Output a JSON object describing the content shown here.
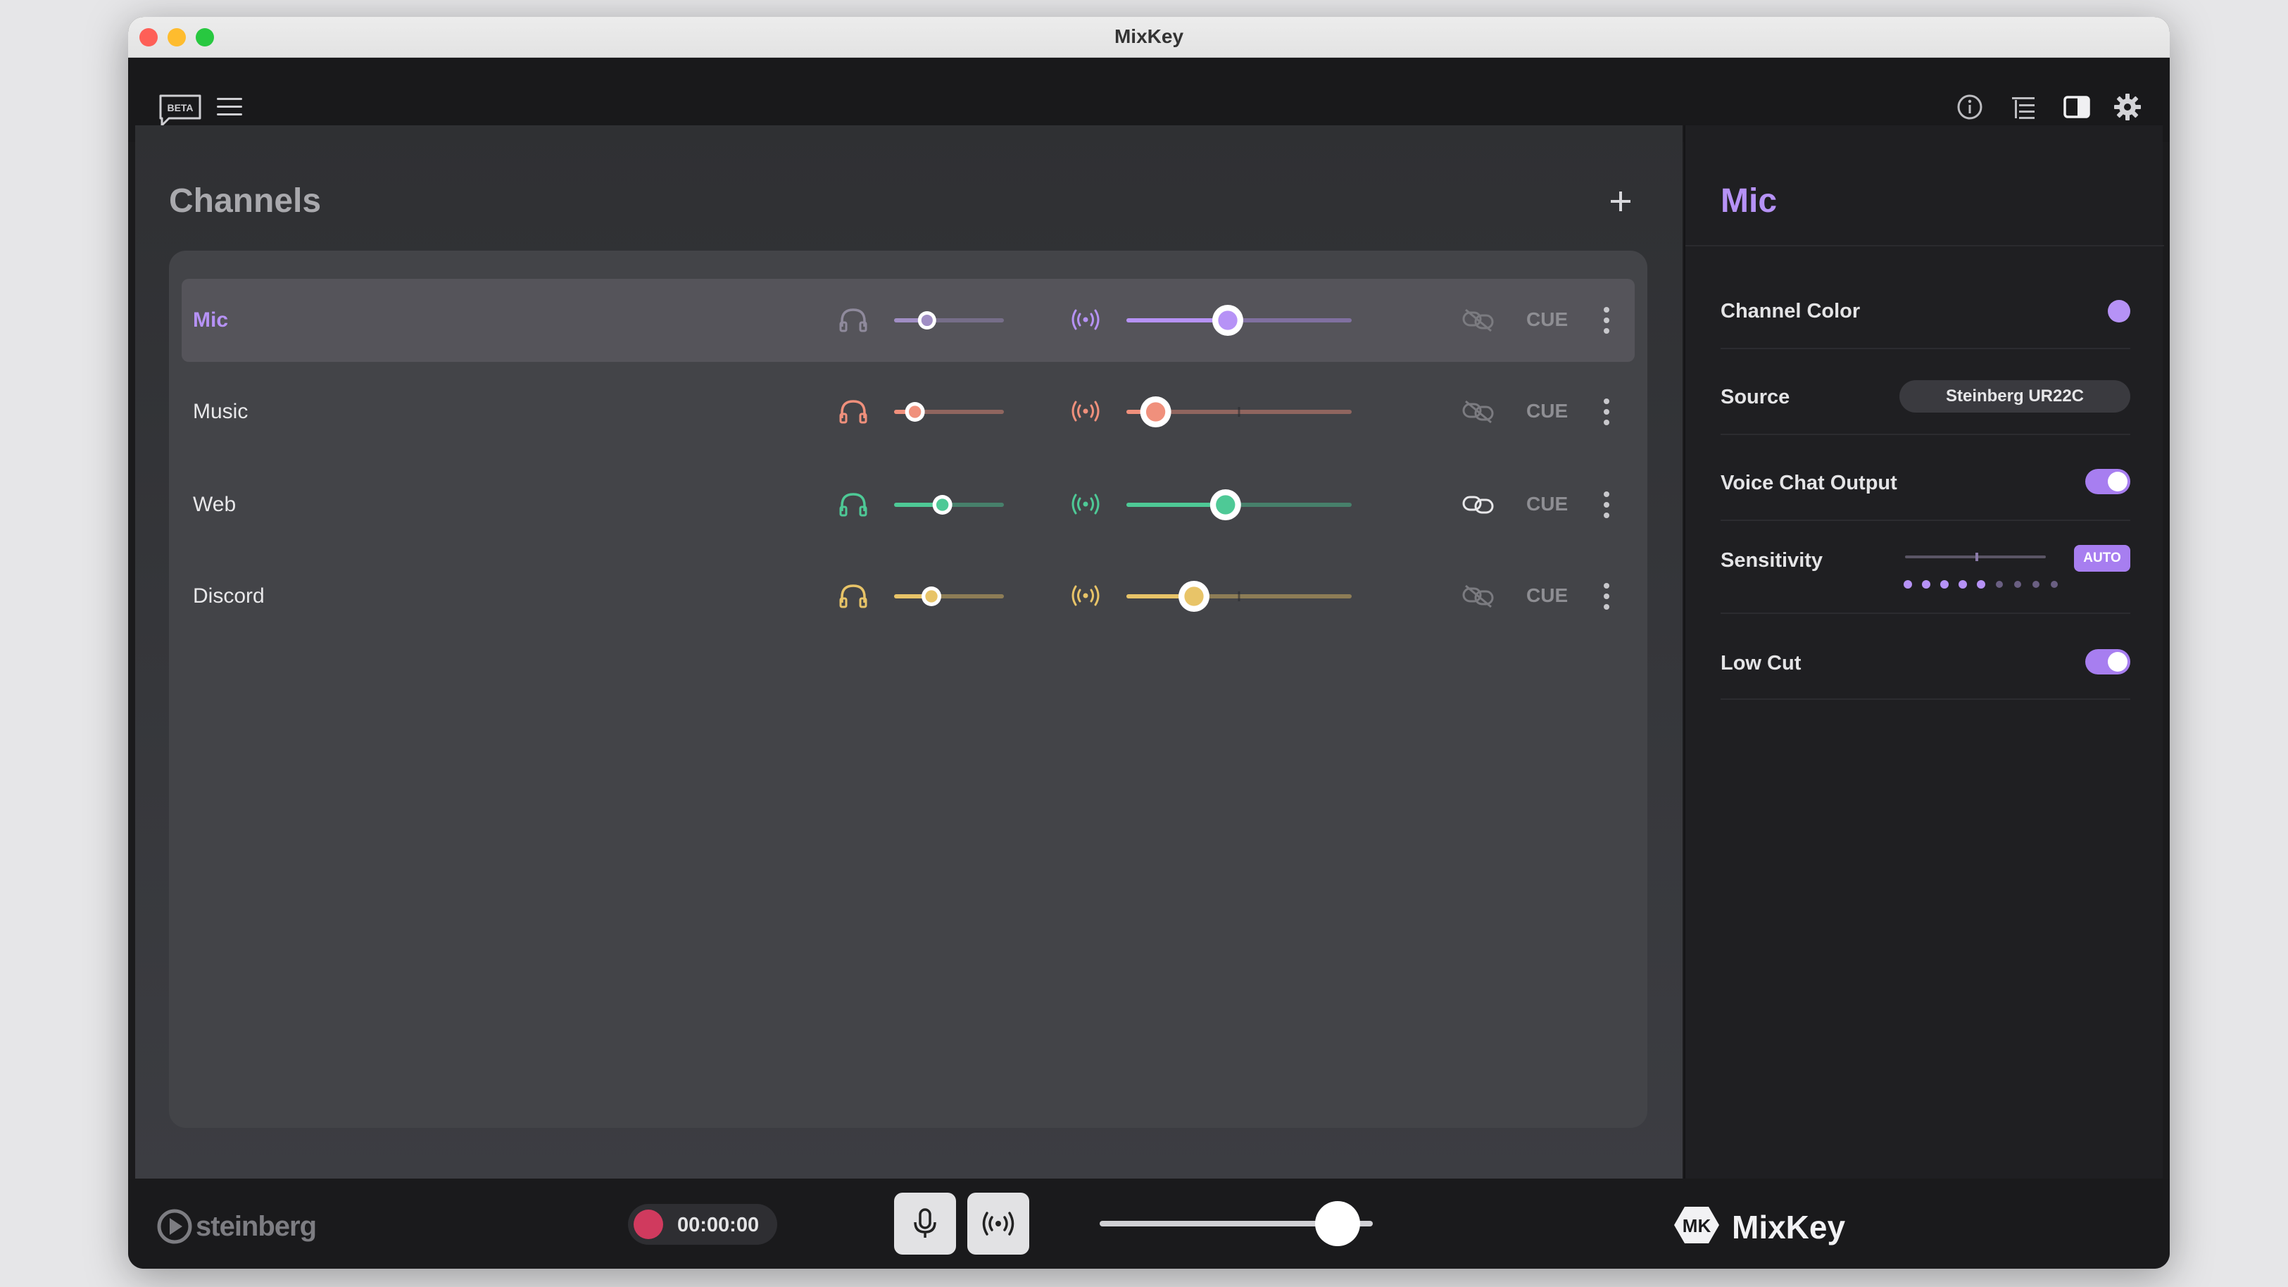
{
  "window": {
    "title": "MixKey"
  },
  "toolbar": {
    "beta_label": "BETA"
  },
  "channels": {
    "title": "Channels",
    "cue_label": "CUE",
    "rows": [
      {
        "name": "Mic",
        "color": "#b692f6",
        "selected": true,
        "headphone_level": 0.3,
        "stream_level": 0.45,
        "linked": false
      },
      {
        "name": "Music",
        "color": "#f0907c",
        "selected": false,
        "headphone_level": 0.19,
        "stream_level": 0.13,
        "linked": false
      },
      {
        "name": "Web",
        "color": "#4ec996",
        "selected": false,
        "headphone_level": 0.44,
        "stream_level": 0.44,
        "linked": true
      },
      {
        "name": "Discord",
        "color": "#e8c468",
        "selected": false,
        "headphone_level": 0.34,
        "stream_level": 0.3,
        "linked": false
      }
    ]
  },
  "side": {
    "title": "Mic",
    "channel_color_label": "Channel Color",
    "channel_color": "#b692f6",
    "source_label": "Source",
    "source_value": "Steinberg UR22C",
    "voice_chat_label": "Voice Chat Output",
    "voice_chat_on": true,
    "sensitivity_label": "Sensitivity",
    "sensitivity_auto_label": "AUTO",
    "sensitivity_level": 0.5,
    "low_cut_label": "Low Cut",
    "low_cut_on": true
  },
  "footer": {
    "brand_left": "steinberg",
    "rec_time": "00:00:00",
    "master_level": 0.87,
    "brand_right": "MixKey"
  },
  "icons": {
    "headphones": "headphones-icon",
    "broadcast": "broadcast-icon",
    "link": "link-icon",
    "more": "more-vertical-icon",
    "info": "info-icon",
    "list": "list-icon",
    "panel": "sidebar-panel-icon",
    "settings": "gear-icon",
    "mic": "microphone-icon"
  }
}
